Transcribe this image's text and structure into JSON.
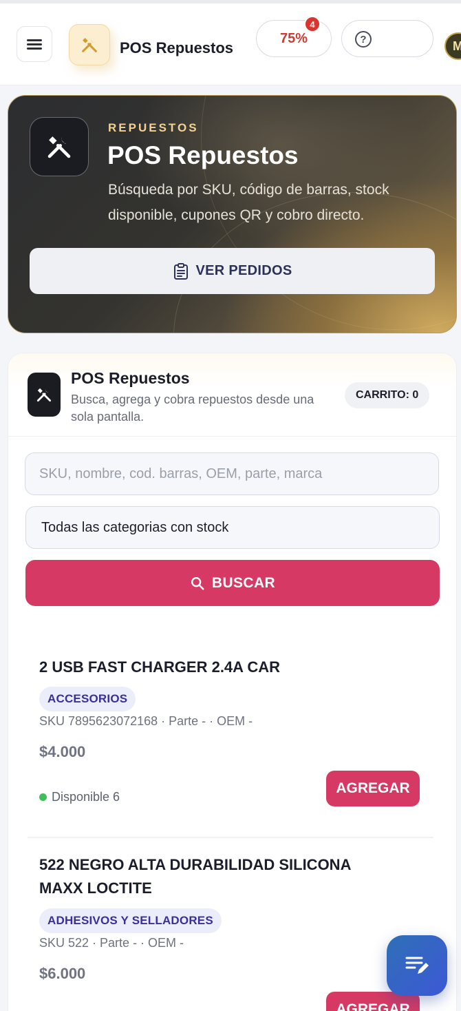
{
  "topbar": {
    "brand": "POS Repuestos",
    "progress_label": "75%",
    "notification_count": "4",
    "help_symbol": "?",
    "avatar_initial": "M"
  },
  "hero": {
    "eyebrow": "REPUESTOS",
    "title": "POS Repuestos",
    "description": "Búsqueda por SKU, código de barras, stock disponible, cupones QR y cobro directo.",
    "button_label": "VER PEDIDOS"
  },
  "pos": {
    "title": "POS Repuestos",
    "subtitle": "Busca, agrega y cobra repuestos desde una sola pantalla.",
    "cart_label": "CARRITO: 0",
    "search_placeholder": "SKU, nombre, cod. barras, OEM, parte, marca",
    "category_selected": "Todas las categorias con stock",
    "search_button": "BUSCAR"
  },
  "products": [
    {
      "name": "2 USB FAST CHARGER 2.4A CAR",
      "category": "ACCESORIOS",
      "sku_line": "SKU 7895623072168 · Parte - · OEM -",
      "price": "$4.000",
      "stock": "Disponible 6",
      "add_label": "AGREGAR"
    },
    {
      "name": "522 NEGRO ALTA DURABILIDAD SILICONA MAXX LOCTITE",
      "category": "ADHESIVOS Y SELLADORES",
      "sku_line": "SKU 522 · Parte - · OEM -",
      "price": "$6.000",
      "add_label": "AGREGAR"
    }
  ],
  "colors": {
    "accent": "#d63a64",
    "gold": "#f3d391",
    "badge_red": "#d8352f",
    "stock_green": "#3fbf5a",
    "tag_text": "#3a2f9c"
  },
  "icons": {
    "menu": "hamburger-icon",
    "logo": "tools-icon",
    "help": "help-circle-icon",
    "orders": "clipboard-icon",
    "search": "search-icon",
    "fab": "notes-edit-icon"
  }
}
